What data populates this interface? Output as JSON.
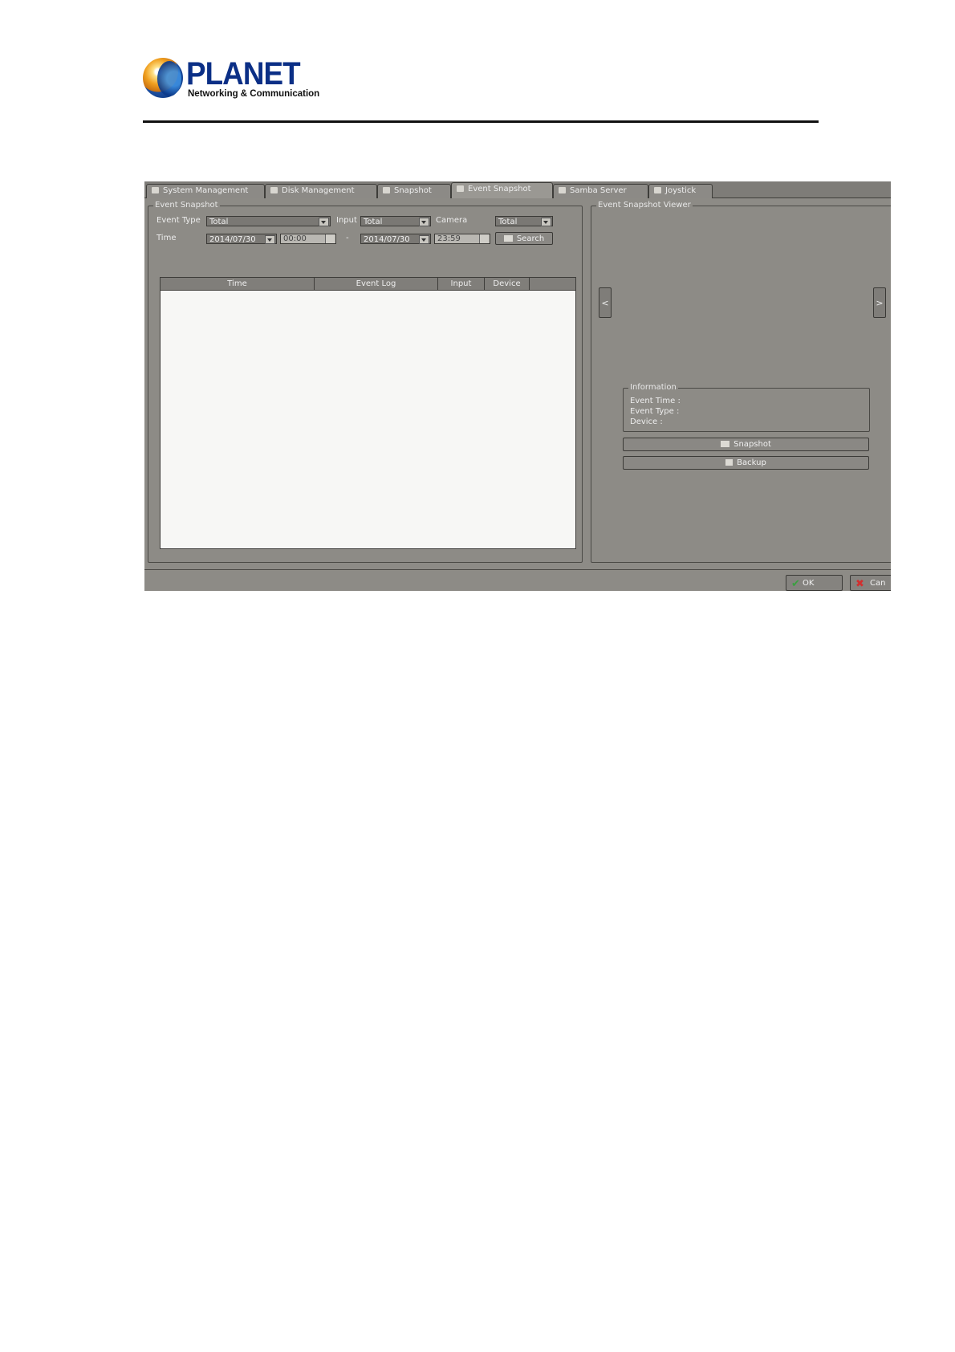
{
  "logo": {
    "brand": "PLANET",
    "tagline": "Networking & Communication"
  },
  "ui": {
    "tabs": [
      {
        "label": "System Management",
        "icon": "shield-icon"
      },
      {
        "label": "Disk Management",
        "icon": "disk-icon"
      },
      {
        "label": "Snapshot",
        "icon": "snapshot-icon"
      },
      {
        "label": "Event Snapshot",
        "icon": "event-snapshot-icon",
        "active": true
      },
      {
        "label": "Samba Server",
        "icon": "server-icon"
      },
      {
        "label": "Joystick",
        "icon": "joystick-icon"
      }
    ],
    "event_snapshot": {
      "group_label": "Event Snapshot",
      "event_type_label": "Event Type",
      "event_type_value": "Total",
      "input_label": "Input",
      "input_value": "Total",
      "camera_label": "Camera",
      "camera_value": "Total",
      "time_label": "Time",
      "start_date": "2014/07/30",
      "start_time": "00:00",
      "range_sep": "-",
      "end_date": "2014/07/30",
      "end_time": "23:59",
      "search_label": "Search",
      "columns": [
        "Time",
        "Event Log",
        "Input",
        "Device"
      ]
    },
    "viewer": {
      "group_label": "Event Snapshot Viewer",
      "prev_label": "<",
      "next_label": ">",
      "info_label": "Information",
      "event_time_label": "Event Time :",
      "event_type_label": "Event Type :",
      "device_label": "Device :",
      "snapshot_button": "Snapshot",
      "backup_button": "Backup"
    },
    "footer": {
      "ok_label": "OK",
      "cancel_label": "Can"
    }
  },
  "colors": {
    "logo_blue": "#0b2f86",
    "panel_gray": "#8d8b86",
    "ok_green": "#3aa040",
    "cancel_red": "#d03030"
  }
}
